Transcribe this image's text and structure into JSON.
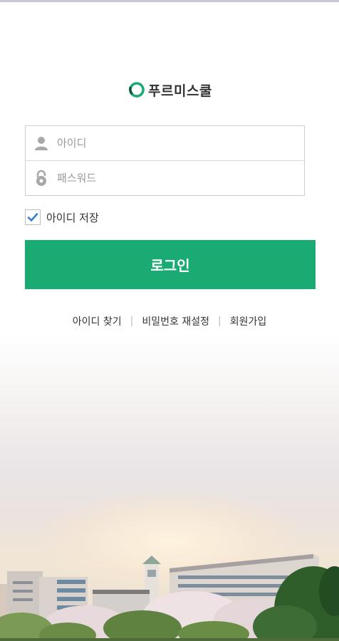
{
  "brand": {
    "name": "푸르미스쿨",
    "logo_icon": "ring-logo-icon",
    "colors": {
      "logo_green": "#1aab73",
      "logo_dark": "#0c5a3c"
    }
  },
  "login_form": {
    "id_field": {
      "placeholder": "아이디",
      "value": "",
      "icon": "user-icon"
    },
    "password_field": {
      "placeholder": "패스워드",
      "value": "",
      "icon": "lock-icon"
    },
    "remember_id": {
      "label": "아이디 저장",
      "checked": true,
      "check_color": "#2f7ecf"
    },
    "submit": {
      "label": "로그인",
      "color": "#1aab73"
    }
  },
  "links": {
    "find_id": "아이디 찾기",
    "reset_password": "비밀번호 재설정",
    "sign_up": "회원가입"
  },
  "background": {
    "scene": "campus-illustration"
  }
}
